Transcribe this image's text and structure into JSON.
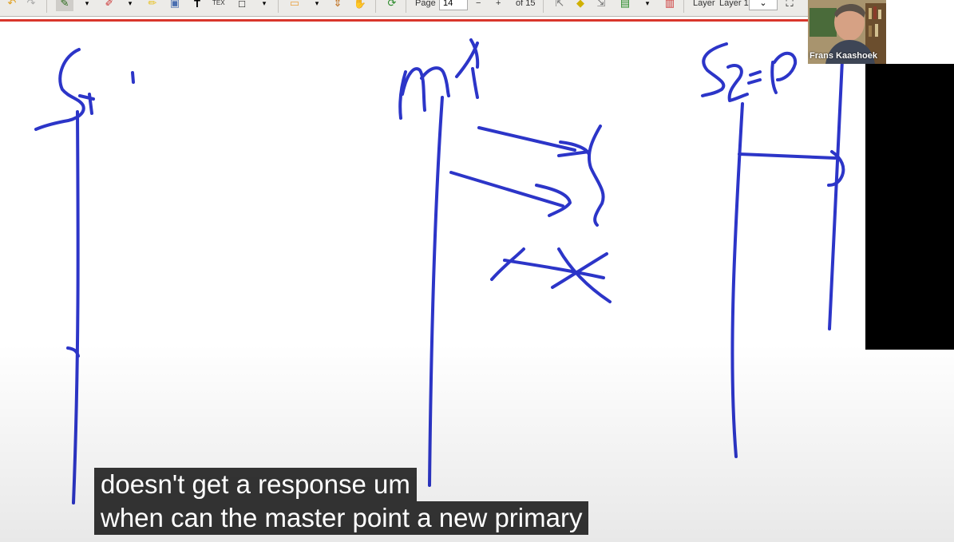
{
  "toolbar": {
    "page_label": "Page",
    "page_value": "14",
    "page_of": "of 15",
    "minus_label": "−",
    "plus_label": "+",
    "layer_label": "Layer",
    "layer_value": "Layer 1",
    "tex_label": "TEX"
  },
  "webcam": {
    "name": "Frans Kaashoek"
  },
  "captions": {
    "line1": "doesn't get a response um",
    "line2": "when can the master point a new primary"
  },
  "colors": {
    "ink": "#2c35c8",
    "toolbar_bg": "#ecebe8",
    "accent_line": "#d9362c"
  }
}
